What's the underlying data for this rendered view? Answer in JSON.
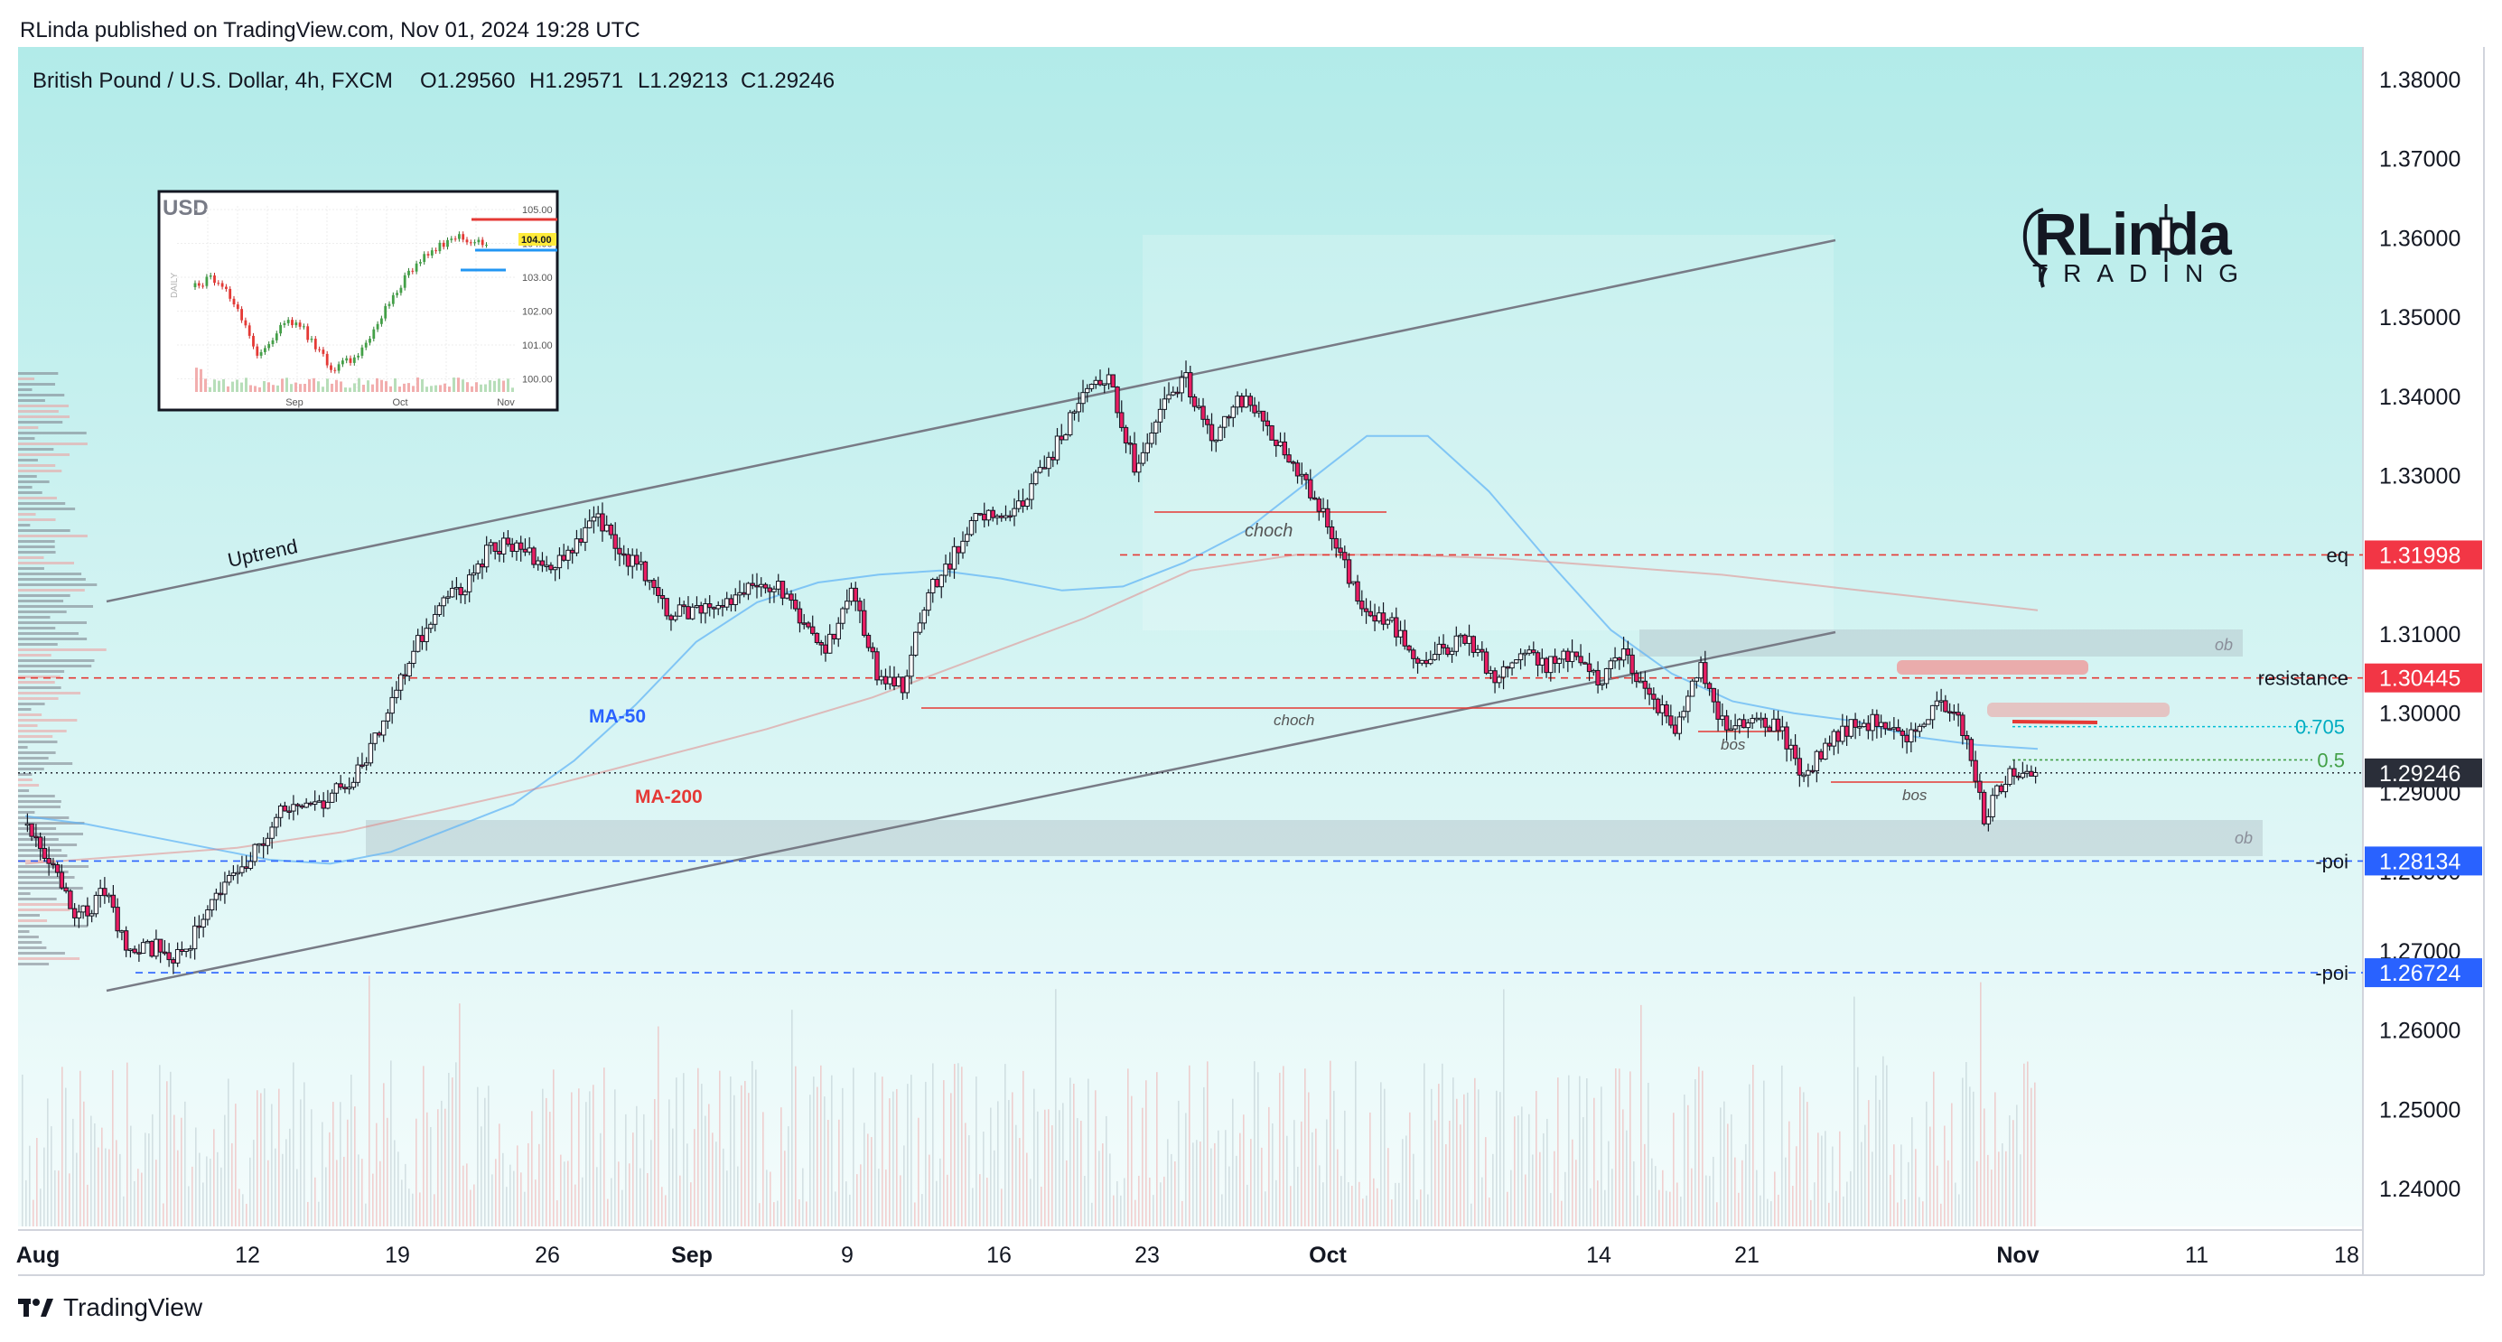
{
  "publisher_line": "RLinda published on TradingView.com, Nov 01, 2024 19:28 UTC",
  "footer_brand": "TradingView",
  "watermark": {
    "brand_top": "RLinda",
    "brand_bottom": "TRADING"
  },
  "legend": {
    "symbol": "British Pound / U.S. Dollar, 4h, FXCM",
    "open": "O1.29560",
    "high": "H1.29571",
    "low": "L1.29213",
    "close": "C1.29246"
  },
  "colors": {
    "up": "#26a69a",
    "down": "#ef5350",
    "candle_up_body": "#ffffff",
    "candle_down_body": "#e91e63",
    "ma50": "#64b5f6",
    "ma200": "#e57373",
    "channel": "#787b86",
    "resistance": "#e53935",
    "poi": "#2962ff",
    "bg_top": "#b2ebe9",
    "bg_bottom": "#f4fcfc"
  },
  "inset": {
    "title": "USD",
    "side_label": "DAILY",
    "y_ticks": [
      "105.00",
      "104.00",
      "103.00",
      "102.00",
      "101.00",
      "100.00"
    ],
    "x_ticks": [
      "Sep",
      "Oct",
      "Nov"
    ],
    "price_tag": "104.00"
  },
  "chart_data": {
    "type": "candlestick",
    "title": "British Pound / U.S. Dollar, 4h, FXCM",
    "ylim": [
      1.235,
      1.385
    ],
    "y_ticks": [
      "1.38000",
      "1.37000",
      "1.36000",
      "1.35000",
      "1.34000",
      "1.33000",
      "1.32000",
      "1.31000",
      "1.30000",
      "1.29000",
      "1.28000",
      "1.27000",
      "1.26000",
      "1.25000",
      "1.24000"
    ],
    "x_ticks": [
      "Aug",
      "12",
      "19",
      "26",
      "Sep",
      "9",
      "16",
      "23",
      "Oct",
      "14",
      "21",
      "Nov",
      "11",
      "18"
    ],
    "close_series": [
      1.286,
      1.281,
      1.274,
      1.2775,
      1.2695,
      1.2705,
      1.269,
      1.276,
      1.279,
      1.2835,
      1.288,
      1.288,
      1.29,
      1.2935,
      1.3,
      1.308,
      1.3135,
      1.316,
      1.321,
      1.3215,
      1.318,
      1.3195,
      1.325,
      1.3205,
      1.3175,
      1.3125,
      1.313,
      1.314,
      1.3155,
      1.3165,
      1.312,
      1.3075,
      1.316,
      1.305,
      1.3035,
      1.315,
      1.32,
      1.325,
      1.3245,
      1.3285,
      1.334,
      1.34,
      1.343,
      1.331,
      1.338,
      1.342,
      1.3345,
      1.34,
      1.337,
      1.3315,
      1.3275,
      1.3195,
      1.3125,
      1.311,
      1.307,
      1.308,
      1.3095,
      1.304,
      1.3075,
      1.306,
      1.3075,
      1.304,
      1.308,
      1.302,
      1.2985,
      1.3055,
      1.2975,
      1.299,
      1.2985,
      1.292,
      1.2965,
      1.2985,
      1.299,
      1.296,
      1.301,
      1.3005,
      1.287,
      1.293,
      1.2925
    ],
    "moving_averages": [
      {
        "name": "MA-50",
        "values": [
          1.287,
          1.286,
          1.2845,
          1.283,
          1.2815,
          1.281,
          1.2825,
          1.2855,
          1.2885,
          1.294,
          1.301,
          1.309,
          1.314,
          1.3165,
          1.3175,
          1.318,
          1.317,
          1.3155,
          1.316,
          1.319,
          1.323,
          1.329,
          1.335,
          1.335,
          1.328,
          1.319,
          1.3105,
          1.305,
          1.3015,
          1.3,
          1.299,
          1.297,
          1.296,
          1.2955
        ]
      },
      {
        "name": "MA-200",
        "values": [
          1.281,
          1.282,
          1.283,
          1.285,
          1.288,
          1.291,
          1.2945,
          1.298,
          1.302,
          1.307,
          1.312,
          1.318,
          1.32,
          1.32,
          1.3195,
          1.3185,
          1.3175,
          1.316,
          1.3145,
          1.313
        ]
      }
    ],
    "levels": [
      {
        "name": "eq",
        "value": 1.31998
      },
      {
        "name": "resistance",
        "value": 1.30445
      },
      {
        "name": "poi",
        "value": 1.28134
      },
      {
        "name": "poi",
        "value": 1.26724
      },
      {
        "name": "0.705",
        "value": 1.2983
      },
      {
        "name": "0.5",
        "value": 1.2941
      }
    ],
    "current_price": 1.29246,
    "annotations": [
      "Uptrend",
      "MA-50",
      "MA-200",
      "choch",
      "choch",
      "bos",
      "bos",
      "ob",
      "ob"
    ]
  }
}
